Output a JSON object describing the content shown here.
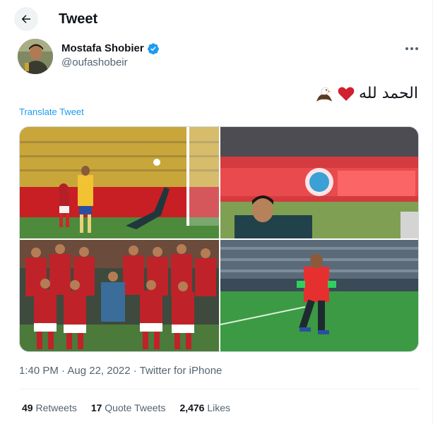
{
  "header": {
    "title": "Tweet"
  },
  "author": {
    "name": "Mostafa Shobier",
    "handle": "@oufashobeir",
    "verified": true
  },
  "tweet": {
    "text": "الحمد لله",
    "emojis": [
      "red-heart",
      "eagle"
    ],
    "translate_label": "Translate Tweet",
    "photos": [
      "stadium-save-photo",
      "goalkeeper-closeup-photo",
      "team-lineup-photo",
      "goalkeeper-warmup-photo"
    ]
  },
  "meta": {
    "line": "1:40 PM · Aug 22, 2022 · Twitter for iPhone"
  },
  "stats": {
    "retweets_count": "49",
    "retweets_label": "Retweets",
    "quotes_count": "17",
    "quotes_label": "Quote Tweets",
    "likes_count": "2,476",
    "likes_label": "Likes"
  },
  "colors": {
    "accent": "#1d9bf0",
    "secondary_text": "#536471",
    "primary_text": "#0f1419",
    "heart": "#d1202e"
  }
}
